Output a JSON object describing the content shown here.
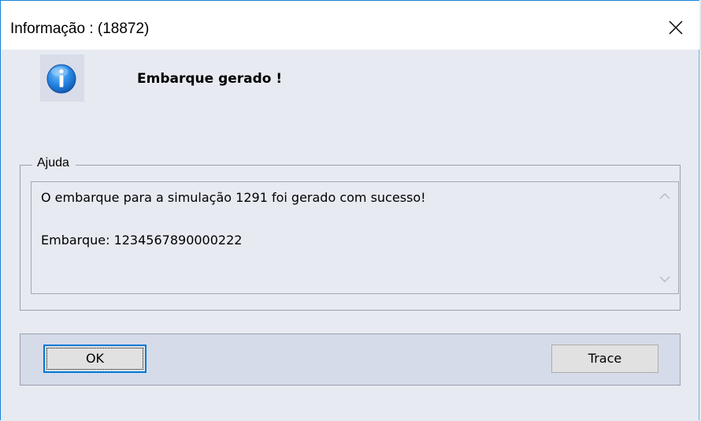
{
  "window": {
    "title": "Informação : (18872)",
    "close_icon": "close-icon"
  },
  "message": {
    "icon": "info-icon",
    "title": "Embarque gerado !"
  },
  "help": {
    "legend": "Ajuda",
    "lines": [
      "O embarque para a simulação 1291 foi gerado com sucesso!",
      "Embarque: 1234567890000222"
    ]
  },
  "buttons": {
    "ok_label": "OK",
    "trace_label": "Trace"
  },
  "colors": {
    "accent": "#0078d7",
    "info_icon": "#1e7fd6",
    "background": "#e7eaf1"
  }
}
